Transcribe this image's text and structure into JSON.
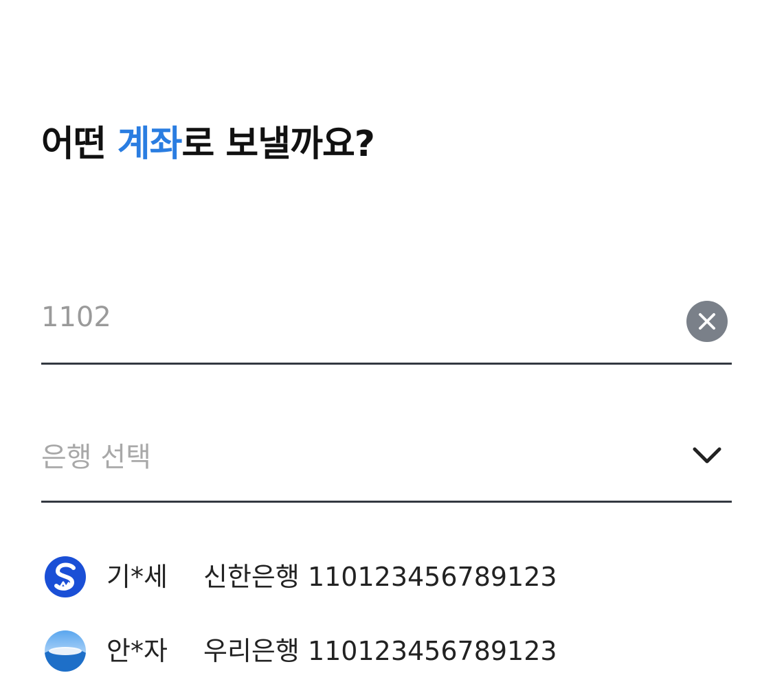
{
  "title": {
    "prefix": "어떤 ",
    "highlight": "계좌",
    "suffix": "로 보낼까요?"
  },
  "account_input": {
    "value": "1102",
    "clear_icon": "close-icon"
  },
  "bank_select": {
    "placeholder": "은행 선택",
    "icon": "chevron-down-icon"
  },
  "recent_accounts": [
    {
      "name": "기*세",
      "bank": "신한은행",
      "account_number": "110123456789123",
      "logo": "shinhan-logo"
    },
    {
      "name": "안*자",
      "bank": "우리은행",
      "account_number": "110123456789123",
      "logo": "woori-logo"
    }
  ],
  "colors": {
    "accent": "#2a7de1",
    "clear_button": "#7a8089",
    "divider": "#333840",
    "placeholder": "#9a9a9a",
    "shinhan_blue": "#1a4fd6",
    "woori_blue": "#1e6fc8"
  }
}
